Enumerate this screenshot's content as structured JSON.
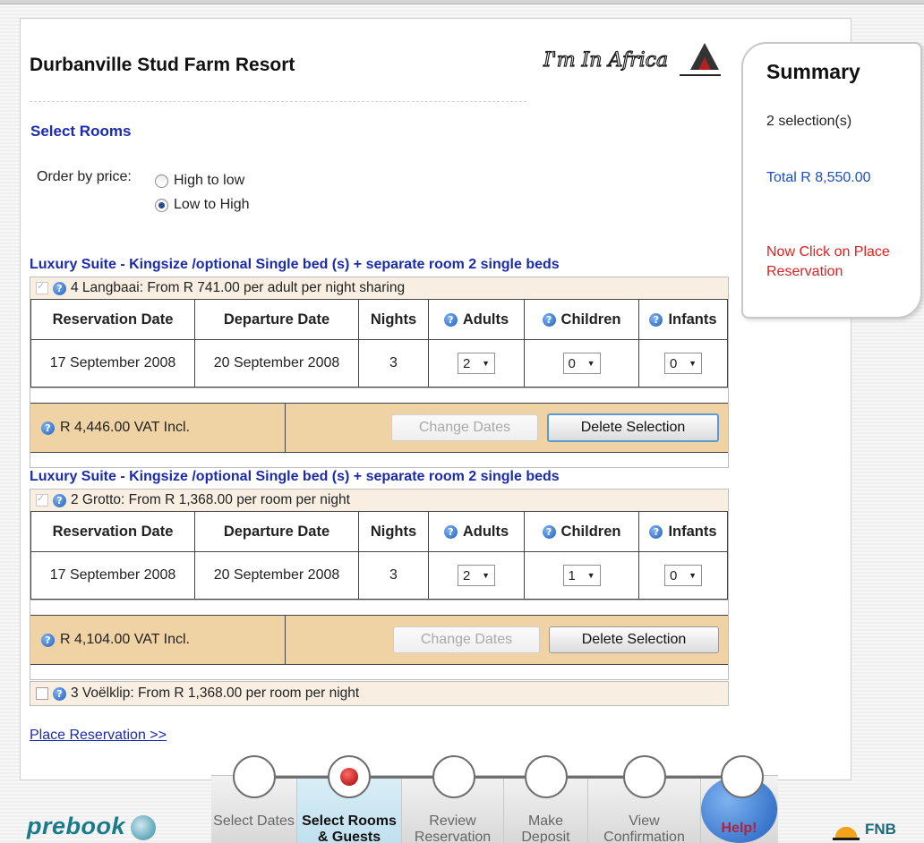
{
  "hotel": {
    "name": "Durbanville Stud Farm Resort"
  },
  "logo": {
    "text": "I'm In Africa"
  },
  "section": {
    "title": "Select Rooms"
  },
  "order": {
    "label": "Order by price:",
    "options": [
      "High to low",
      "Low to High"
    ],
    "selected": "Low to High"
  },
  "headers": {
    "reservation_date": "Reservation Date",
    "departure_date": "Departure Date",
    "nights": "Nights",
    "adults": "Adults",
    "children": "Children",
    "infants": "Infants"
  },
  "rooms": [
    {
      "heading": "Luxury Suite - Kingsize /optional Single bed (s) + separate room 2 single beds",
      "checked": true,
      "line": "4 Langbaai:  From R 741.00 per adult per night sharing",
      "reservation_date": "17 September 2008",
      "departure_date": "20 September 2008",
      "nights": "3",
      "adults": "2",
      "children": "0",
      "infants": "0",
      "price": "R 4,446.00 VAT Incl.",
      "change_label": "Change Dates",
      "delete_label": "Delete Selection"
    },
    {
      "heading": "Luxury Suite - Kingsize /optional Single bed (s) + separate room 2 single beds",
      "checked": true,
      "line": "2 Grotto:  From R 1,368.00 per room per night",
      "reservation_date": "17 September 2008",
      "departure_date": "20 September 2008",
      "nights": "3",
      "adults": "2",
      "children": "1",
      "infants": "0",
      "price": "R 4,104.00 VAT Incl.",
      "change_label": "Change Dates",
      "delete_label": "Delete Selection"
    }
  ],
  "unselected_room": {
    "line": "3 Voëlklip:  From R 1,368.00 per room per night",
    "checked": false
  },
  "place_link": "Place Reservation >>",
  "summary": {
    "title": "Summary",
    "count": "2 selection(s)",
    "total": "Total R 8,550.00",
    "cta": "Now Click on Place Reservation",
    "cta_color": "#e02020",
    "total_color": "#1a4fc0"
  },
  "footer": {
    "brand": "prebook",
    "partner": "FNB",
    "steps": [
      {
        "label": "Select Dates",
        "active": false
      },
      {
        "label": "Select Rooms & Guests",
        "active": true
      },
      {
        "label": "Review Reservation",
        "active": false
      },
      {
        "label": "Make Deposit",
        "active": false
      },
      {
        "label": "View Confirmation",
        "active": false
      },
      {
        "label": "Help!",
        "active": false
      }
    ]
  }
}
